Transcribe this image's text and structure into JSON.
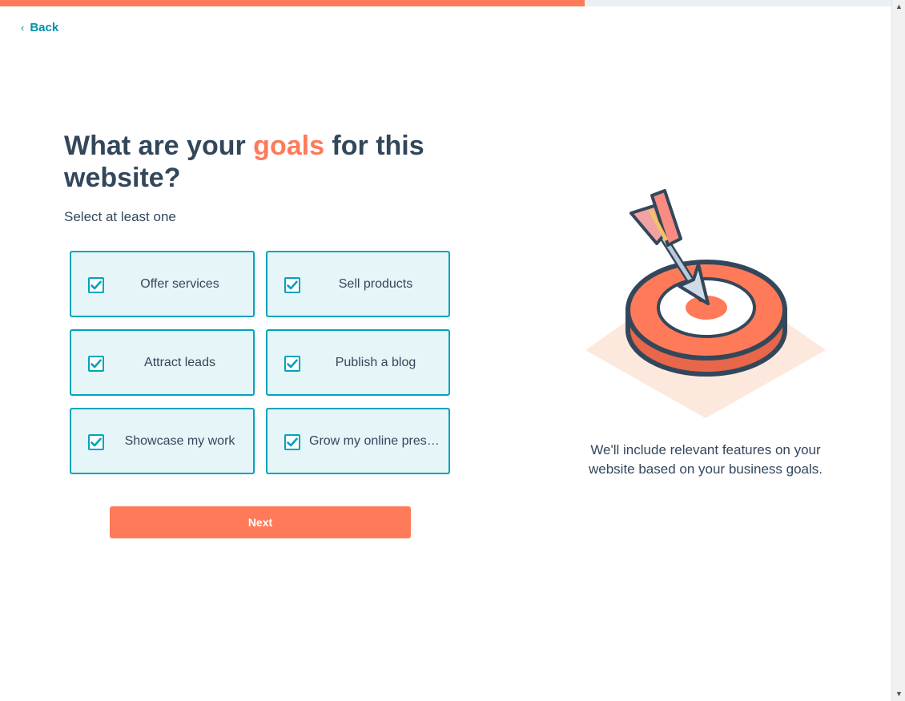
{
  "progress": {
    "percent": 65.6
  },
  "nav": {
    "back_label": "Back"
  },
  "heading": {
    "part1": "What are your ",
    "accent": "goals",
    "part2": " for this website?"
  },
  "subtitle": "Select at least one",
  "options": [
    {
      "label": "Offer services",
      "checked": true
    },
    {
      "label": "Sell products",
      "checked": true
    },
    {
      "label": "Attract leads",
      "checked": true
    },
    {
      "label": "Publish a blog",
      "checked": true
    },
    {
      "label": "Showcase my work",
      "checked": true
    },
    {
      "label": "Grow my online presence",
      "checked": true
    }
  ],
  "next_label": "Next",
  "caption": "We'll include relevant features on your website based on your business goals.",
  "colors": {
    "accent": "#ff7a59",
    "teal": "#00a4bd",
    "option_bg": "#e5f5f8",
    "text": "#33475b"
  },
  "icons": {
    "back": "chevron-left-icon",
    "checkbox": "check-icon",
    "illustration": "target-arrow-illustration"
  }
}
